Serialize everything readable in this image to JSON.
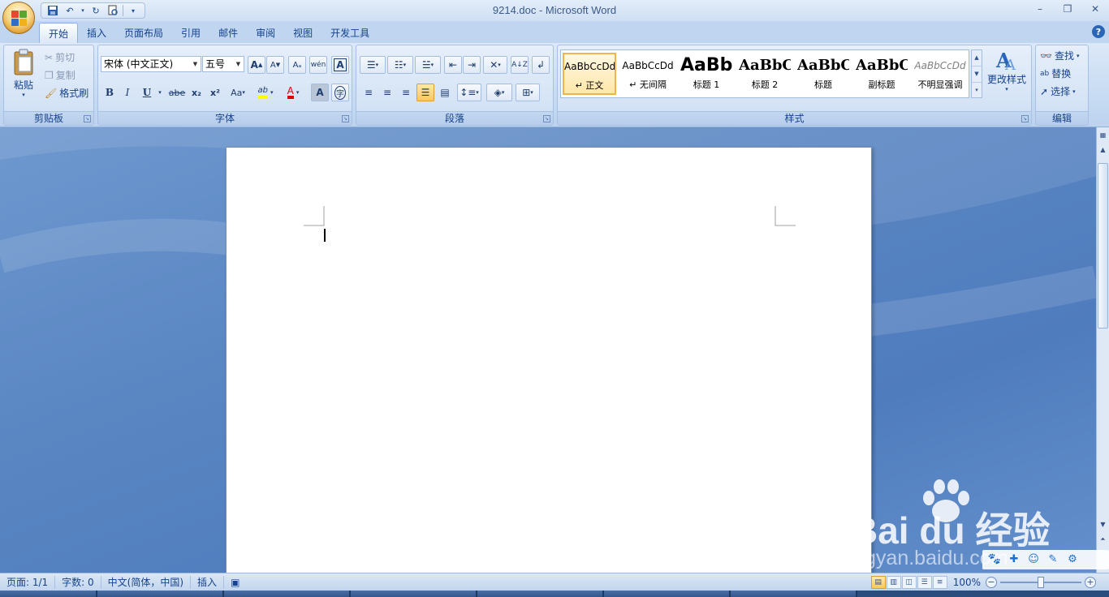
{
  "window": {
    "title": "9214.doc - Microsoft Word",
    "controls": [
      "–",
      "❐",
      "✕"
    ]
  },
  "quick_access": {
    "icons": [
      "save-icon",
      "undo-icon",
      "redo-icon",
      "print-preview-icon",
      "customize-icon"
    ]
  },
  "tabs": [
    {
      "label": "开始",
      "active": true
    },
    {
      "label": "插入",
      "active": false
    },
    {
      "label": "页面布局",
      "active": false
    },
    {
      "label": "引用",
      "active": false
    },
    {
      "label": "邮件",
      "active": false
    },
    {
      "label": "审阅",
      "active": false
    },
    {
      "label": "视图",
      "active": false
    },
    {
      "label": "开发工具",
      "active": false
    }
  ],
  "clipboard": {
    "group_label": "剪贴板",
    "paste_label": "粘贴",
    "cut_label": "剪切",
    "copy_label": "复制",
    "format_painter_label": "格式刷"
  },
  "font": {
    "group_label": "字体",
    "font_name": "宋体 (中文正文)",
    "font_size": "五号",
    "grow_label": "A",
    "shrink_label": "A",
    "phonetic_label": "wén",
    "bold_label": "B",
    "italic_label": "I",
    "underline_label": "U",
    "strike_label": "abe",
    "subscript_label": "x₂",
    "superscript_label": "x²",
    "case_label": "Aa",
    "highlight_label": "ab",
    "font_color_label": "A",
    "shading_label": "A",
    "enclose_label": "字",
    "font_color": "#e00000",
    "highlight_color": "#ffff00"
  },
  "paragraph": {
    "group_label": "段落"
  },
  "styles": {
    "group_label": "样式",
    "items": [
      {
        "sample": "AaBbCcDd",
        "name": "↵ 正文",
        "active": true
      },
      {
        "sample": "AaBbCcDd",
        "name": "↵ 无间隔",
        "active": false
      },
      {
        "sample": "AaBb",
        "name": "标题 1",
        "active": false
      },
      {
        "sample": "AaBbC",
        "name": "标题 2",
        "active": false
      },
      {
        "sample": "AaBbC",
        "name": "标题",
        "active": false
      },
      {
        "sample": "AaBbC",
        "name": "副标题",
        "active": false
      },
      {
        "sample": "AaBbCcDd",
        "name": "不明显强调",
        "active": false
      }
    ],
    "change_styles_label": "更改样式"
  },
  "editing": {
    "group_label": "编辑",
    "find_label": "查找",
    "replace_label": "替换",
    "select_label": "选择"
  },
  "status": {
    "page": "页面: 1/1",
    "words": "字数: 0",
    "language": "中文(简体，中国)",
    "mode": "插入",
    "zoom": "100%",
    "zoom_percent": 100
  },
  "watermark": {
    "brand": "Bai du 经验",
    "url": "jingyan.baidu.com"
  }
}
